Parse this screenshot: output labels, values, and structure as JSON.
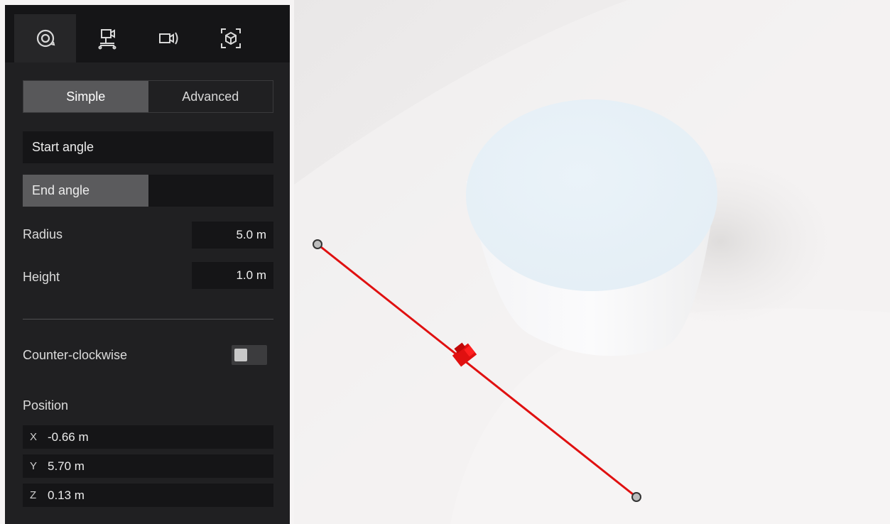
{
  "tabs": [
    {
      "icon": "rotate-orbit-icon",
      "active": true
    },
    {
      "icon": "camera-on-tripod-icon",
      "active": false
    },
    {
      "icon": "video-camera-icon",
      "active": false
    },
    {
      "icon": "3d-cube-icon",
      "active": false
    }
  ],
  "mode": {
    "simple": "Simple",
    "advanced": "Advanced",
    "selected": "Simple"
  },
  "start_angle": {
    "label": "Start angle",
    "level": 0
  },
  "end_angle": {
    "label": "End angle",
    "level": 0.5
  },
  "radius": {
    "label": "Radius",
    "value": "5.0 m"
  },
  "height": {
    "label": "Height",
    "value": "1.0 m"
  },
  "counter_clockwise": {
    "label": "Counter-clockwise",
    "on": false
  },
  "position": {
    "label": "Position",
    "x": {
      "axis": "X",
      "value": "-0.66 m"
    },
    "y": {
      "axis": "Y",
      "value": "5.70 m"
    },
    "z": {
      "axis": "Z",
      "value": "0.13 m"
    }
  },
  "colors": {
    "accent_line": "#e01010",
    "panel_bg": "#202022",
    "scene_bg": "#f6f4f4"
  }
}
